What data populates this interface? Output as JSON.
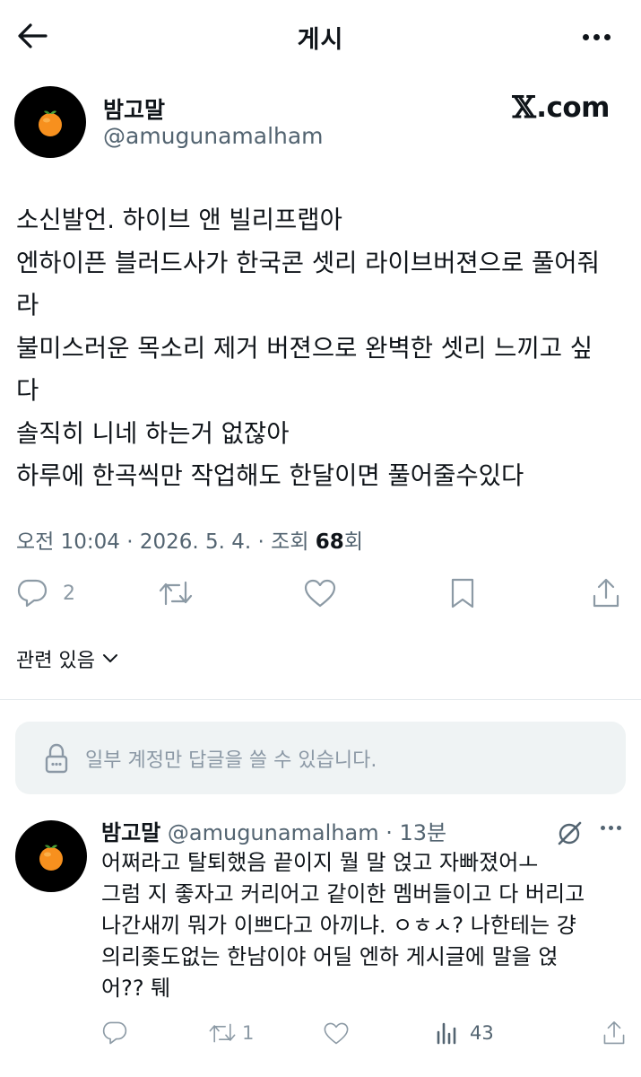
{
  "header": {
    "title": "게시",
    "back_icon": "arrow-left-icon",
    "more_icon": "more-horizontal-icon"
  },
  "post": {
    "author_name": "밤고말",
    "author_handle": "@amugunamalham",
    "avatar_icon": "tangerine-icon",
    "source_logo": "X.com",
    "source_logo_glyph": "𝕏",
    "source_logo_text": ".com",
    "lines": [
      "소신발언. 하이브 앤 빌리프랩아",
      "엔하이픈 블러드사가 한국콘 셋리 라이브버젼으로 풀어줘",
      "라",
      "불미스러운 목소리 제거 버젼으로 완벽한 셋리 느끼고 싶",
      "다",
      "솔직히 니네 하는거 없잖아",
      "하루에 한곡씩만 작업해도 한달이면 풀어줄수있다"
    ],
    "time": "오전 10:04",
    "date": "2026. 5. 4.",
    "views_label": "조회",
    "views_count": "68",
    "views_unit": "회",
    "reply_count": "2"
  },
  "related": {
    "label": "관련 있음"
  },
  "reply_restriction": {
    "text": "일부 계정만 답글을 쓸 수 있습니다."
  },
  "reply": {
    "author_name": "밤고말",
    "author_handle": "@amugunamalham",
    "time": "13분",
    "lines": [
      "어쩌라고 탈퇴했음 끝이지 뭘 말 얹고 자빠졌어ㅗ",
      "그럼 지 좋자고 커리어고 같이한 멤버들이고 다 버리고",
      "나간새끼 뭐가 이쁘다고 아끼냐. ㅇㅎㅅ? 나한테는 걍",
      "의리좆도없는 한남이야 어딜 엔하 게시글에 말을 얹",
      "어?? 퉤"
    ],
    "repost_count": "1",
    "views_count": "43"
  },
  "colors": {
    "text": "#0f1419",
    "secondary": "#536471",
    "icon": "#8c9aa5",
    "reply_box_bg": "#eff3f4",
    "tangerine": "#f7901e"
  }
}
